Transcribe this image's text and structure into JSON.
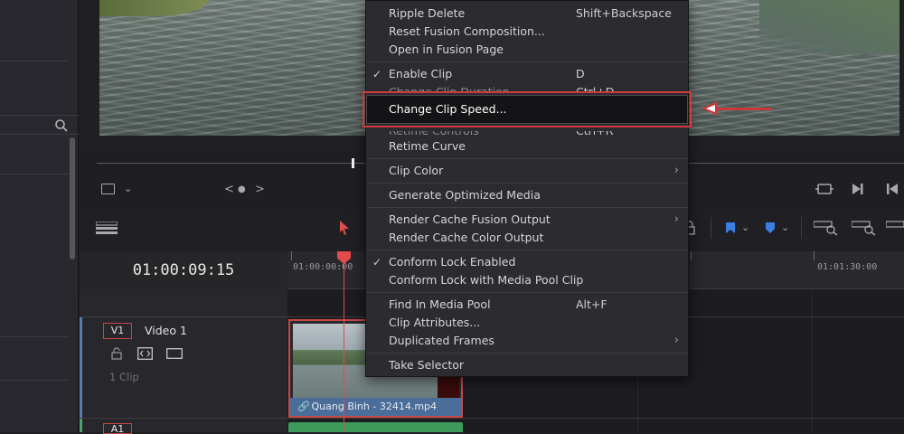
{
  "viewer": {
    "nav_prev": "<",
    "nav_dot": "●",
    "nav_next": ">"
  },
  "timeline": {
    "timecode": "01:00:09:15",
    "ruler_labels": [
      "01:00:00:00",
      "01:01:30:00"
    ]
  },
  "track": {
    "badge": "V1",
    "name": "Video 1",
    "clip_count": "1 Clip",
    "badge2": "A1"
  },
  "clip": {
    "name": "Quang Binh - 32414.mp4"
  },
  "context_menu": {
    "items": [
      {
        "label": "Ripple Delete",
        "shortcut": "Shift+Backspace"
      },
      {
        "label": "Reset Fusion Composition..."
      },
      {
        "label": "Open in Fusion Page"
      },
      {
        "label": "Enable Clip",
        "shortcut": "D",
        "checked": true
      },
      {
        "label": "Change Clip Duration...",
        "shortcut": "Ctrl+D"
      },
      {
        "label": "Change Clip Speed..."
      },
      {
        "label": "Retime Controls",
        "shortcut": "Ctrl+R"
      },
      {
        "label": "Retime Curve"
      },
      {
        "label": "Clip Color"
      },
      {
        "label": "Generate Optimized Media"
      },
      {
        "label": "Render Cache Fusion Output"
      },
      {
        "label": "Render Cache Color Output"
      },
      {
        "label": "Conform Lock Enabled",
        "checked": true
      },
      {
        "label": "Conform Lock with Media Pool Clip"
      },
      {
        "label": "Find In Media Pool",
        "shortcut": "Alt+F"
      },
      {
        "label": "Clip Attributes..."
      },
      {
        "label": "Duplicated Frames"
      },
      {
        "label": "Take Selector"
      }
    ],
    "check_glyph": "✓",
    "submenu_glyph": "›"
  },
  "colors": {
    "highlight_border": "#d43a3a",
    "playhead": "#e04b4b",
    "clip_label_bg": "#4a6e99",
    "audio_clip": "#3c9a5a"
  }
}
